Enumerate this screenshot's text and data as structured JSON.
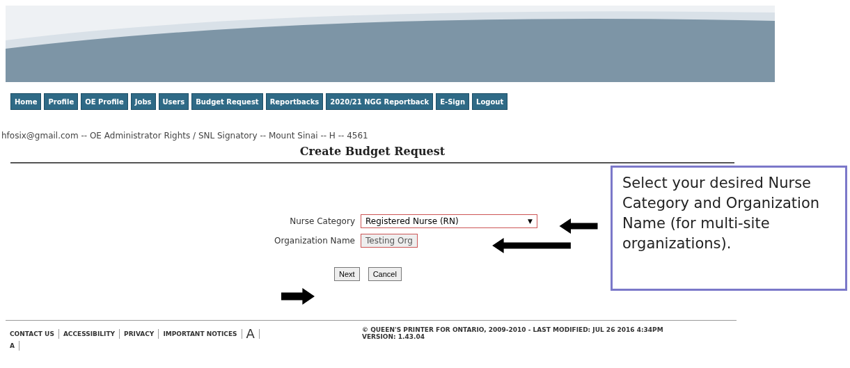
{
  "nav": [
    {
      "label": "Home"
    },
    {
      "label": "Profile"
    },
    {
      "label": "OE Profile"
    },
    {
      "label": "Jobs"
    },
    {
      "label": "Users"
    },
    {
      "label": "Budget Request"
    },
    {
      "label": "Reportbacks"
    },
    {
      "label": "2020/21 NGG Reportback"
    },
    {
      "label": "E-Sign"
    },
    {
      "label": "Logout"
    }
  ],
  "user_line": "hfosix@gmail.com -- OE Administrator Rights / SNL Signatory -- Mount Sinai -- H -- 4561",
  "page_title": "Create Budget Request",
  "form": {
    "nurse_category": {
      "label": "Nurse Category",
      "value": "Registered Nurse (RN)",
      "caret": "▼"
    },
    "organization_name": {
      "label": "Organization Name",
      "value": "Testing Org"
    },
    "buttons": [
      "Next",
      "Cancel"
    ]
  },
  "callout": {
    "text": "Select your desired Nurse Category and Organization Name (for multi-site organizations)."
  },
  "footer": {
    "links": [
      "CONTACT US",
      "ACCESSIBILITY",
      "PRIVACY",
      "IMPORTANT NOTICES"
    ],
    "font_large": "A",
    "font_small": "A",
    "copyright": "© QUEEN'S PRINTER FOR ONTARIO, 2009-2010 - LAST MODIFIED: JUL 26 2016 4:34PM",
    "version": "VERSION: 1.43.04"
  }
}
